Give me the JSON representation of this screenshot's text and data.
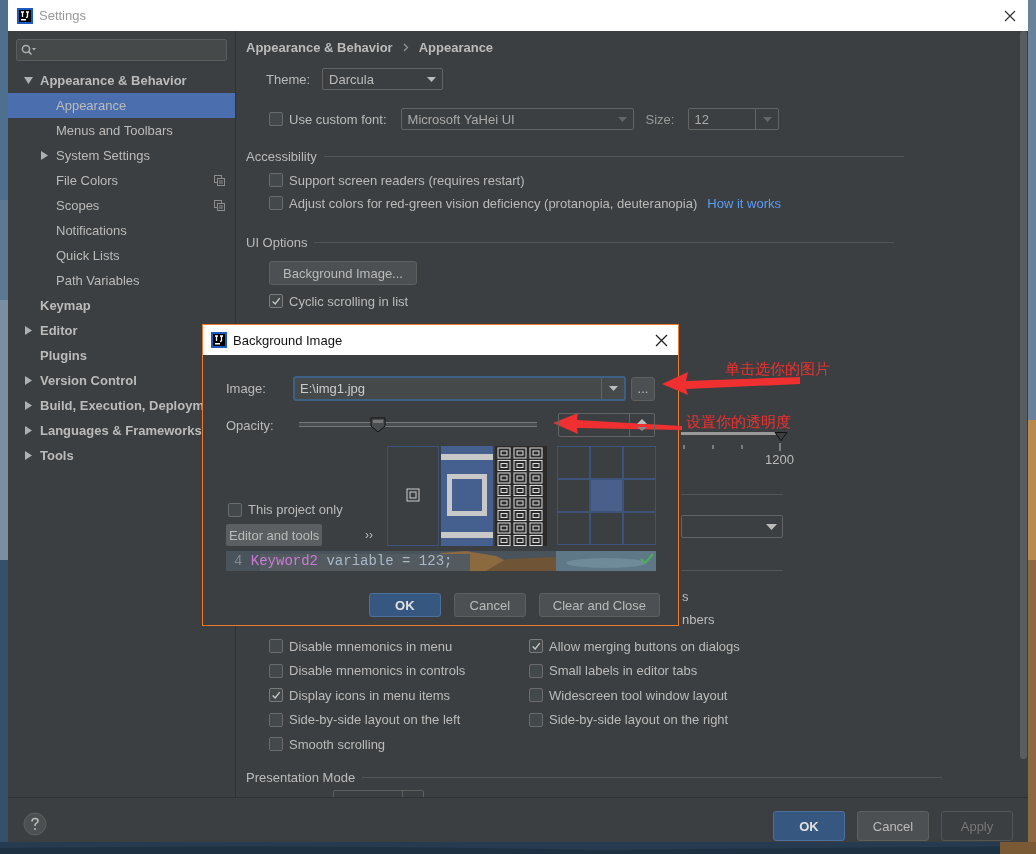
{
  "window": {
    "title": "Settings"
  },
  "sidebar": {
    "items": [
      {
        "label": "Appearance & Behavior",
        "kind": "folder",
        "expanded": true,
        "selected": false,
        "project_scoped": false,
        "children": [
          {
            "label": "Appearance",
            "kind": "page",
            "selected": true,
            "project_scoped": false
          },
          {
            "label": "Menus and Toolbars",
            "kind": "page",
            "selected": false,
            "project_scoped": false
          },
          {
            "label": "System Settings",
            "kind": "folder",
            "expanded": false,
            "selected": false,
            "project_scoped": false
          },
          {
            "label": "File Colors",
            "kind": "page",
            "selected": false,
            "project_scoped": true
          },
          {
            "label": "Scopes",
            "kind": "page",
            "selected": false,
            "project_scoped": true
          },
          {
            "label": "Notifications",
            "kind": "page",
            "selected": false,
            "project_scoped": false
          },
          {
            "label": "Quick Lists",
            "kind": "page",
            "selected": false,
            "project_scoped": false
          },
          {
            "label": "Path Variables",
            "kind": "page",
            "selected": false,
            "project_scoped": false
          }
        ]
      },
      {
        "label": "Keymap",
        "kind": "page",
        "selected": false,
        "project_scoped": false
      },
      {
        "label": "Editor",
        "kind": "folder",
        "expanded": false,
        "selected": false,
        "project_scoped": false
      },
      {
        "label": "Plugins",
        "kind": "page",
        "selected": false,
        "project_scoped": false
      },
      {
        "label": "Version Control",
        "kind": "folder",
        "expanded": false,
        "selected": false,
        "project_scoped": false
      },
      {
        "label": "Build, Execution, Deploym",
        "kind": "folder",
        "expanded": false,
        "selected": false,
        "project_scoped": false
      },
      {
        "label": "Languages & Frameworks",
        "kind": "folder",
        "expanded": false,
        "selected": false,
        "project_scoped": false
      },
      {
        "label": "Tools",
        "kind": "folder",
        "expanded": false,
        "selected": false,
        "project_scoped": false
      }
    ]
  },
  "breadcrumb": [
    "Appearance & Behavior",
    "Appearance"
  ],
  "theme": {
    "label": "Theme:",
    "value": "Darcula"
  },
  "custom_font": {
    "label": "Use custom font:",
    "checked": false,
    "font": "Microsoft YaHei UI",
    "size_label": "Size:",
    "size": "12"
  },
  "accessibility": {
    "title": "Accessibility",
    "options": [
      {
        "label": "Support screen readers (requires restart)",
        "checked": false
      },
      {
        "label": "Adjust colors for red-green vision deficiency (protanopia, deuteranopia)",
        "checked": false,
        "link": "How it works"
      }
    ]
  },
  "ui_options": {
    "title": "UI Options",
    "background_button": "Background Image...",
    "cyclic": {
      "label": "Cyclic scrolling in list",
      "checked": true
    },
    "partly_hidden": {
      "slider": {
        "level": 1
      },
      "slider_label": "1200",
      "line_1": "s",
      "line_2": "nbers"
    },
    "left": [
      {
        "label": "Disable mnemonics in menu",
        "checked": false
      },
      {
        "label": "Disable mnemonics in controls",
        "checked": false
      },
      {
        "label": "Display icons in menu items",
        "checked": true
      },
      {
        "label": "Side-by-side layout on the left",
        "checked": false
      },
      {
        "label": "Smooth scrolling",
        "checked": false
      }
    ],
    "right": [
      {
        "label": "Allow merging buttons on dialogs",
        "checked": true
      },
      {
        "label": "Small labels in editor tabs",
        "checked": false
      },
      {
        "label": "Widescreen tool window layout",
        "checked": false
      },
      {
        "label": "Side-by-side layout on the right",
        "checked": false
      }
    ]
  },
  "presentation": {
    "title": "Presentation Mode"
  },
  "footer": {
    "buttons": [
      {
        "label": "OK",
        "kind": "primary"
      },
      {
        "label": "Cancel",
        "kind": "normal"
      },
      {
        "label": "Apply",
        "kind": "disabled"
      }
    ]
  },
  "dialog": {
    "title": "Background Image",
    "image_label": "Image:",
    "image_path": "E:\\img1.jpg",
    "browse": "...",
    "opacity_label": "Opacity:",
    "opacity": {
      "level": 0.33
    },
    "fill_modes": [
      {
        "kind": "centered"
      },
      {
        "kind": "stretched"
      },
      {
        "kind": "tiled"
      }
    ],
    "anchors": [
      {
        "selected": false
      },
      {
        "selected": false
      },
      {
        "selected": false
      },
      {
        "selected": false
      },
      {
        "selected": true
      },
      {
        "selected": false
      },
      {
        "selected": false
      },
      {
        "selected": false
      },
      {
        "selected": false
      }
    ],
    "project_only": {
      "label": "This project only",
      "checked": false
    },
    "target": "Editor and tools",
    "more": "››",
    "preview": {
      "line_number": "4",
      "keyword": "Keyword2",
      "code": "variable = 123;"
    },
    "buttons": [
      {
        "label": "OK",
        "kind": "primary"
      },
      {
        "label": "Cancel",
        "kind": "normal"
      },
      {
        "label": "Clear and Close",
        "kind": "normal"
      }
    ]
  },
  "annotations": [
    {
      "text": "单击选你的图片"
    },
    {
      "text": "设置你的透明度"
    }
  ]
}
